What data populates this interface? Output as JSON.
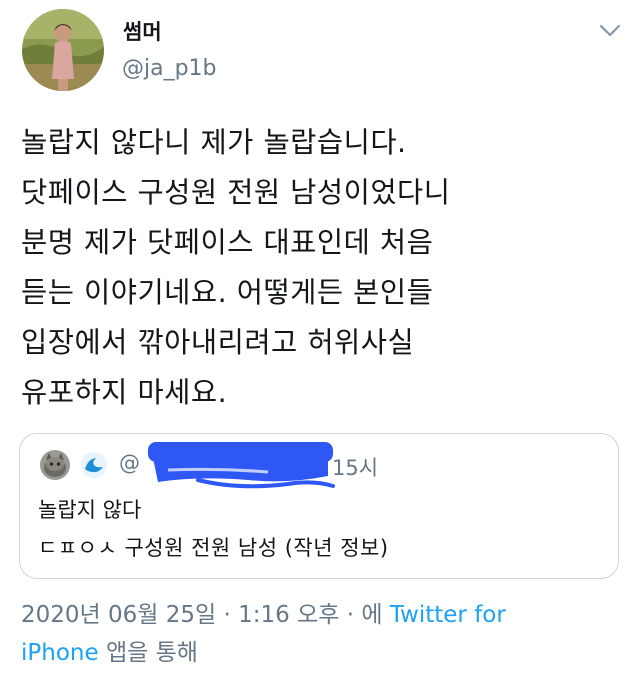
{
  "user": {
    "display_name": "썸머",
    "handle": "@ja_p1b"
  },
  "tweet": {
    "lines": [
      "놀랍지 않다니 제가 놀랍습니다.",
      "닷페이스 구성원 전원 남성이었다니",
      "분명 제가 닷페이스 대표인데 처음",
      "듣는 이야기네요. 어떻게든 본인들",
      "입장에서 깎아내리려고 허위사실",
      "유포하지 마세요."
    ]
  },
  "quote": {
    "handle_visible": "@",
    "time": "15시",
    "line1": "놀랍지 않다",
    "line2": "ㄷㅍㅇㅅ 구성원 전원 남성 (작년 정보)"
  },
  "meta": {
    "date": "2020년 06월 25일 · 1:16 오후 · 에",
    "source_link": "Twitter for iPhone",
    "source_suffix": "앱을 통해",
    "line1_link": "Twitter for",
    "line2_link": "iPhone"
  },
  "icons": {
    "more": "chevron-down-icon",
    "quote_app": "wave-icon"
  },
  "colors": {
    "link": "#1da1f2",
    "secondary_text": "#657786",
    "border": "#ccd6dd",
    "redaction": "#2f57f3"
  }
}
